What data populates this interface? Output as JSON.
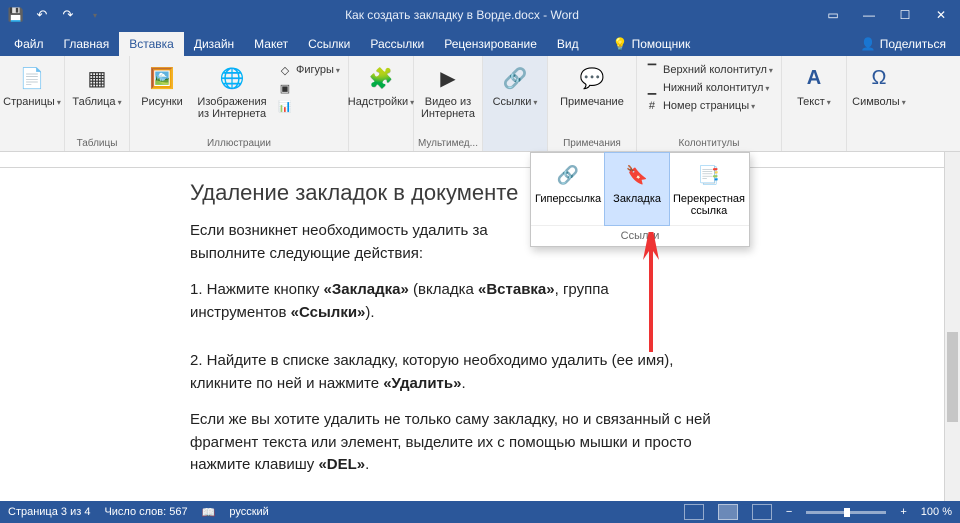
{
  "title": "Как создать закладку в Ворде.docx  -  Word",
  "tabs": [
    "Файл",
    "Главная",
    "Вставка",
    "Дизайн",
    "Макет",
    "Ссылки",
    "Рассылки",
    "Рецензирование",
    "Вид"
  ],
  "activeTab": 2,
  "tell": "Помощник",
  "share": "Поделиться",
  "ribbon": {
    "pages": {
      "btn": "Страницы",
      "label": ""
    },
    "tables": {
      "btn": "Таблица",
      "label": "Таблицы"
    },
    "illus": {
      "pic": "Рисунки",
      "online": "Изображения из Интернета",
      "shapes": "Фигуры",
      "smartart": "",
      "chart": "",
      "screenshot": "",
      "label": "Иллюстрации"
    },
    "addins": {
      "btn": "Надстройки",
      "label": ""
    },
    "media": {
      "btn": "Видео из Интернета",
      "label": "Мультимед..."
    },
    "links": {
      "btn": "Ссылки",
      "label": ""
    },
    "comments": {
      "btn": "Примечание",
      "label": "Примечания"
    },
    "hf": {
      "header": "Верхний колонтитул",
      "footer": "Нижний колонтитул",
      "pagenum": "Номер страницы",
      "label": "Колонтитулы"
    },
    "text": {
      "btn": "Текст"
    },
    "symbols": {
      "btn": "Символы"
    }
  },
  "dropdown": {
    "hyperlink": "Гиперссылка",
    "bookmark": "Закладка",
    "cross": "Перекрестная ссылка",
    "label": "Ссылки"
  },
  "doc": {
    "heading": "Удаление закладок в документе",
    "p1a": "Если возникнет необходимость удалить за",
    "p1b": "выполните следующие действия:",
    "p2a": "1. Нажмите кнопку ",
    "p2b": "«Закладка»",
    "p2c": " (вкладка ",
    "p2d": "«Вставка»",
    "p2e": ", группа",
    "p2f": "инструментов ",
    "p2g": "«Ссылки»",
    "p2h": ").",
    "p3a": "2. Найдите в списке закладку, которую необходимо удалить (ее имя),",
    "p3b": "кликните по ней и нажмите ",
    "p3c": "«Удалить»",
    "p3d": ".",
    "p4a": "Если же вы хотите удалить не только саму закладку, но и связанный с ней",
    "p4b": "фрагмент текста или элемент, выделите их с помощью мышки и просто",
    "p4c": "нажмите клавишу ",
    "p4d": "«DEL»",
    "p4e": "."
  },
  "status": {
    "page": "Страница 3 из 4",
    "words": "Число слов: 567",
    "lang": "русский",
    "zoom": "100 %"
  }
}
